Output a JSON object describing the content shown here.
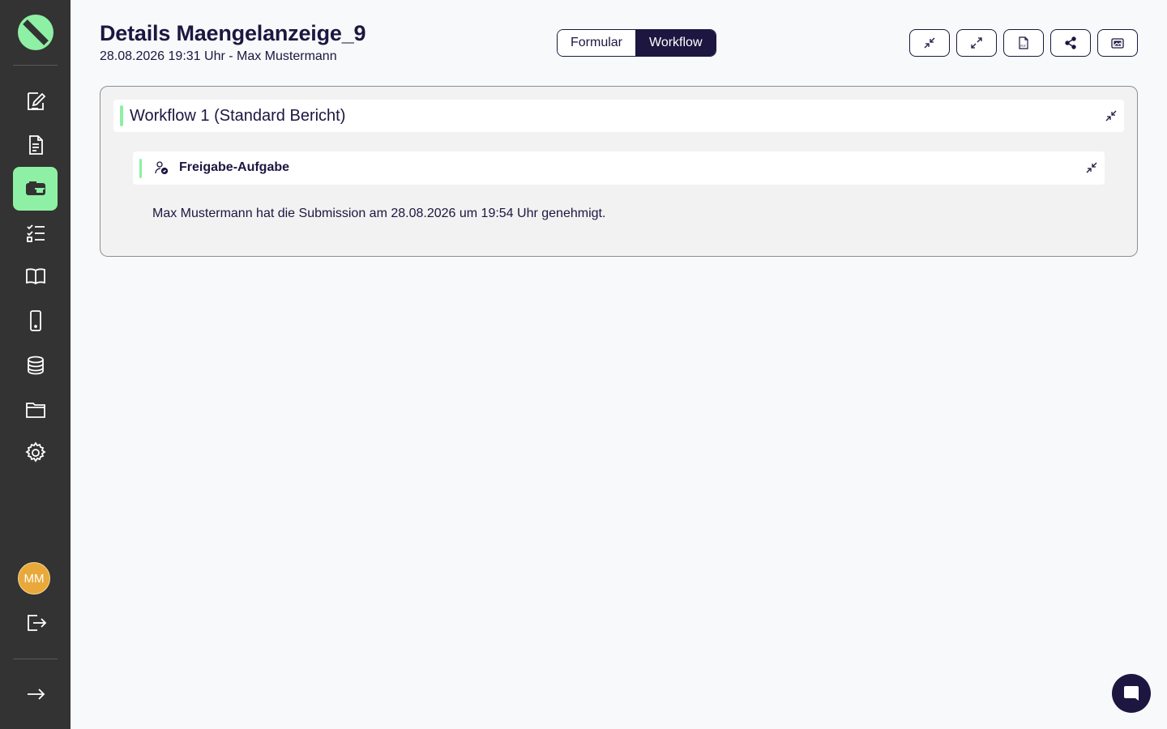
{
  "header": {
    "title": "Details Maengelanzeige_9",
    "subtitle": "28.08.2026 19:31 Uhr - Max Mustermann"
  },
  "view_toggle": {
    "options": [
      "Formular",
      "Workflow"
    ],
    "selected": "Workflow"
  },
  "toolbar": {
    "buttons": [
      "collapse-all-icon",
      "expand-all-icon",
      "pdf-icon",
      "share-icon",
      "image-icon"
    ]
  },
  "sidebar": {
    "items": [
      "edit-form-icon",
      "document-icon",
      "inbox-icon",
      "checklist-icon",
      "book-icon",
      "mobile-icon",
      "database-icon",
      "folder-icon",
      "settings-icon"
    ],
    "active": "inbox-icon",
    "user_initials": "MM"
  },
  "workflow": {
    "title": "Workflow 1 (Standard Bericht)",
    "task": {
      "title": "Freigabe-Aufgabe",
      "message": "Max Mustermann hat die Submission am 28.08.2026 um 19:54 Uhr genehmigt."
    }
  },
  "colors": {
    "accent": "#8ef0a4",
    "primary": "#1d1640",
    "sidebar": "#333333",
    "avatar": "#e9a93a"
  }
}
